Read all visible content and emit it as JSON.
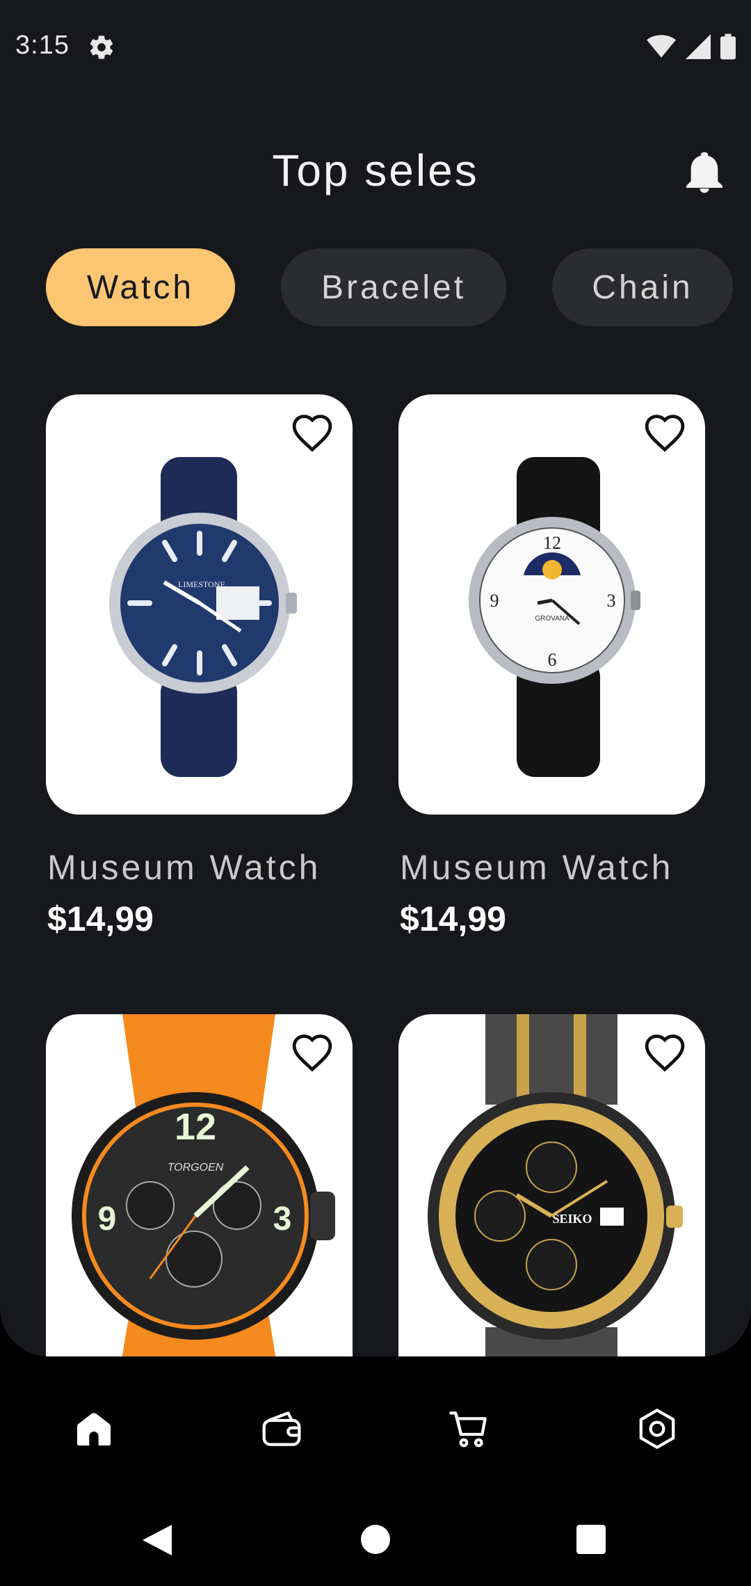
{
  "status_bar": {
    "time": "3:15"
  },
  "header": {
    "title": "Top seles"
  },
  "categories": [
    {
      "label": "Watch",
      "active": true
    },
    {
      "label": "Bracelet",
      "active": false
    },
    {
      "label": "Chain",
      "active": false
    }
  ],
  "products": [
    {
      "name": "Museum Watch",
      "price": "$14,99"
    },
    {
      "name": "Museum Watch",
      "price": "$14,99"
    },
    {
      "name": "",
      "price": ""
    },
    {
      "name": "",
      "price": ""
    }
  ],
  "product_images": [
    {
      "dial_text": "LIMESTONE"
    },
    {
      "dial_text": "GROVANA"
    },
    {
      "dial_text": "TORGOEN"
    },
    {
      "dial_text": "SEIKO"
    }
  ],
  "bottom_nav": [
    "home-icon",
    "wallet-icon",
    "cart-icon",
    "settings-icon"
  ],
  "colors": {
    "accent": "#fbc572",
    "background": "#17181c",
    "chip_idle": "#2b2c30"
  }
}
